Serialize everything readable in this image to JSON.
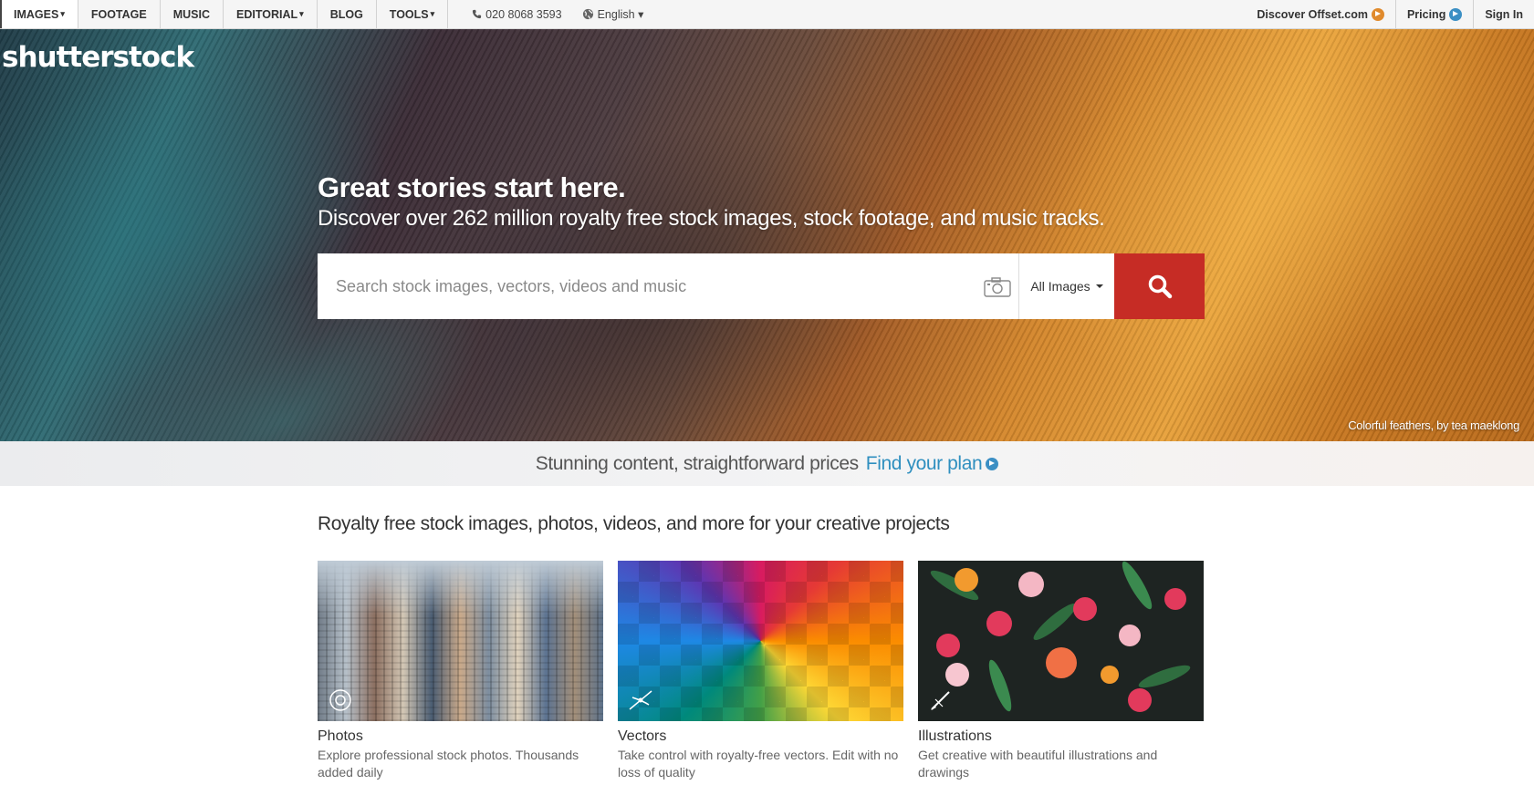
{
  "nav": {
    "items": [
      {
        "label": "IMAGES",
        "caret": "▾"
      },
      {
        "label": "FOOTAGE",
        "caret": ""
      },
      {
        "label": "MUSIC",
        "caret": ""
      },
      {
        "label": "EDITORIAL",
        "caret": "▾"
      },
      {
        "label": "BLOG",
        "caret": ""
      },
      {
        "label": "TOOLS",
        "caret": "▾"
      }
    ],
    "phone": "020 8068 3593",
    "language": "English ▾",
    "offset_link": "Discover Offset.com",
    "pricing_link": "Pricing",
    "signin": "Sign In"
  },
  "hero": {
    "logo": "shutterstock",
    "headline": "Great stories start here.",
    "subline": "Discover over 262 million royalty free stock images, stock footage, and music tracks.",
    "search_placeholder": "Search stock images, vectors, videos and music",
    "search_type": "All Images",
    "credit": "Colorful feathers, by tea maeklong"
  },
  "pricing_strip": {
    "text": "Stunning content, straightforward prices",
    "link": "Find your plan"
  },
  "section": {
    "title": "Royalty free stock images, photos, videos, and more for your creative projects"
  },
  "cards": [
    {
      "title": "Photos",
      "desc": "Explore professional stock photos. Thousands added daily"
    },
    {
      "title": "Vectors",
      "desc": "Take control with royalty-free vectors. Edit with no loss of quality"
    },
    {
      "title": "Illustrations",
      "desc": "Get creative with beautiful illustrations and drawings"
    }
  ],
  "colors": {
    "search_button": "#c62c25",
    "link_blue": "#2f8fbf",
    "offset_orange": "#e08a2c"
  },
  "icons": [
    "phone-icon",
    "globe-icon",
    "camera-icon",
    "search-icon",
    "arrow-circle-icon",
    "photo-icon",
    "vector-pen-icon",
    "brush-icon"
  ]
}
